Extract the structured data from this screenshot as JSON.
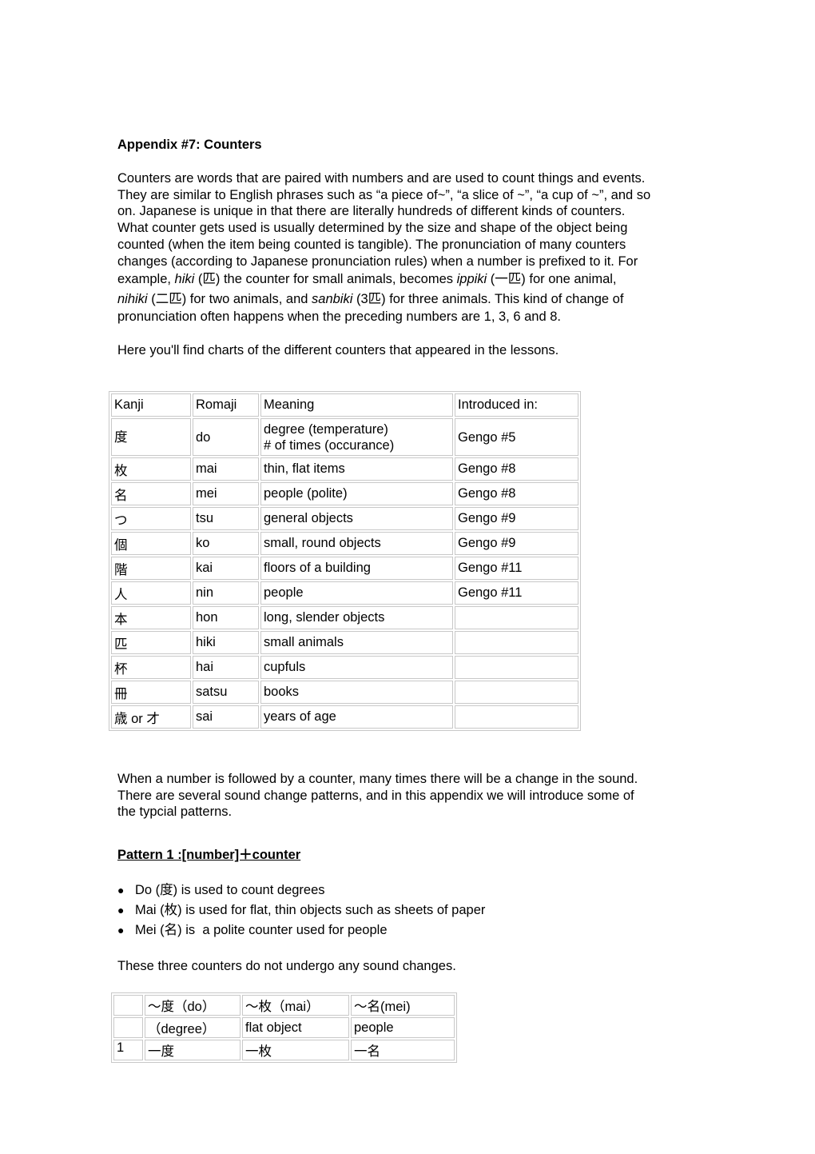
{
  "title": "Appendix #7: Counters",
  "intro": {
    "lines": [
      "Counters are words that are paired with numbers and are used to count things and events.",
      "They are similar to English phrases such as “a piece of~”, “a slice of ~”, “a cup of ~”, and so",
      "on. Japanese is unique in that there are literally hundreds of different kinds of counters.",
      "What counter gets used is usually determined by the size and shape of the object being",
      "counted (when the item being counted is tangible). The pronunciation of many counters",
      "changes (according to Japanese pronunciation rules) when a number is prefixed to it. For"
    ],
    "example_line": {
      "t1": "example, ",
      "i1": "hiki",
      "t2": " (匹) the counter for small animals, becomes ",
      "i2": "ippiki",
      "t3": " (一匹) for one animal,"
    },
    "example_line2": {
      "i1": "nihiki",
      "t1": " (二匹) for two animals, and ",
      "i2": "sanbiki",
      "t2": " (3匹) for three animals. This kind of change of"
    },
    "last_line": "pronunciation often happens when the preceding numbers are 1, 3, 6 and 8."
  },
  "charts_note": "Here you'll find charts of the different counters that appeared in the lessons.",
  "counters_table": {
    "headers": [
      "Kanji",
      "Romaji",
      "Meaning",
      "Introduced in:"
    ],
    "rows": [
      {
        "kanji": "度",
        "romaji": "do",
        "meaning": "degree (temperature)",
        "meaning2": "# of times (occurance)",
        "lesson": "Gengo #5"
      },
      {
        "kanji": "枚",
        "romaji": "mai",
        "meaning": "thin, flat items",
        "lesson": "Gengo #8"
      },
      {
        "kanji": "名",
        "romaji": "mei",
        "meaning": "people (polite)",
        "lesson": "Gengo #8"
      },
      {
        "kanji": "つ",
        "romaji": "tsu",
        "meaning": "general objects",
        "lesson": "Gengo #9"
      },
      {
        "kanji": "個",
        "romaji": "ko",
        "meaning": "small, round objects",
        "lesson": "Gengo #9"
      },
      {
        "kanji": "階",
        "romaji": "kai",
        "meaning": "floors of a building",
        "lesson": "Gengo #11"
      },
      {
        "kanji": "人",
        "romaji": "nin",
        "meaning": "people",
        "lesson": "Gengo #11"
      },
      {
        "kanji": "本",
        "romaji": "hon",
        "meaning": "long, slender objects",
        "lesson": ""
      },
      {
        "kanji": "匹",
        "romaji": "hiki",
        "meaning": "small animals",
        "lesson": ""
      },
      {
        "kanji": "杯",
        "romaji": "hai",
        "meaning": "cupfuls",
        "lesson": ""
      },
      {
        "kanji": "冊",
        "romaji": "satsu",
        "meaning": "books",
        "lesson": ""
      },
      {
        "kanji": "歳 or 才",
        "romaji": "sai",
        "meaning": "years of age",
        "lesson": ""
      }
    ]
  },
  "sound_change_intro": [
    "When a number is followed by a counter, many times there will be a change in the sound.",
    "There are several sound change patterns, and in this appendix we will introduce some of",
    "the typcial patterns."
  ],
  "pattern1": {
    "heading": "Pattern 1 :[number]＋counter",
    "bullets": [
      "Do (度) is used to count degrees",
      "Mai (枚) is used for flat, thin objects such as sheets of paper",
      "Mei (名) is  a polite counter used for people"
    ],
    "note": "These three counters do not undergo any sound changes.",
    "table": {
      "header": [
        "",
        "～度（do）",
        "～枚（mai）",
        "～名(mei)"
      ],
      "subheader": [
        "",
        "（degree）",
        "flat object",
        "people"
      ],
      "rows": [
        [
          "1",
          "一度",
          "一枚",
          "一名"
        ]
      ]
    }
  }
}
